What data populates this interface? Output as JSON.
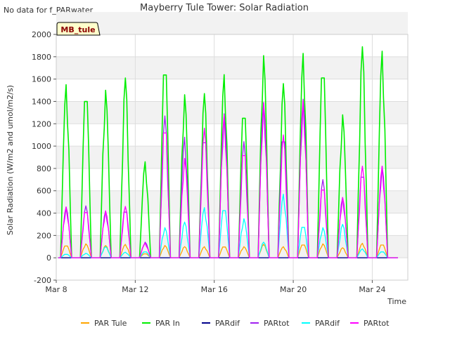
{
  "note": "No data for f_PARwater",
  "chart_data": {
    "type": "line",
    "title": "Mayberry Tule Tower: Solar Radiation",
    "xlabel": "Time",
    "ylabel": "Solar Radiation (W/m2 and umol/m2/s)",
    "badge": "MB_tule",
    "ylim": [
      -200,
      2000
    ],
    "xlim_days": [
      8,
      25.8
    ],
    "y_ticks": [
      -200,
      0,
      200,
      400,
      600,
      800,
      1000,
      1200,
      1400,
      1600,
      1800,
      2000
    ],
    "x_ticks": [
      {
        "day": 8,
        "label": "Mar 8"
      },
      {
        "day": 12,
        "label": "Mar 12"
      },
      {
        "day": 16,
        "label": "Mar 16"
      },
      {
        "day": 20,
        "label": "Mar 20"
      },
      {
        "day": 24,
        "label": "Mar 24"
      }
    ],
    "grid": true,
    "legend_position": "bottom",
    "days": [
      8.5,
      9.5,
      10.5,
      11.5,
      12.5,
      13.5,
      14.5,
      15.5,
      16.5,
      17.5,
      18.5,
      19.5,
      20.5,
      21.5,
      22.5,
      23.5,
      24.5
    ],
    "series": [
      {
        "name": "PAR Tule",
        "color": "#ffa500",
        "values": [
          120,
          125,
          110,
          120,
          40,
          110,
          100,
          100,
          110,
          100,
          120,
          100,
          130,
          125,
          90,
          130,
          130
        ]
      },
      {
        "name": "PAR In",
        "color": "#00ee00",
        "values": [
          1550,
          1590,
          1500,
          1610,
          860,
          1860,
          1460,
          1470,
          1640,
          1420,
          1810,
          1560,
          1830,
          1830,
          1280,
          1890,
          1850
        ]
      },
      {
        "name": "PARdif",
        "color": "#00008b",
        "values": [
          0,
          0,
          0,
          0,
          0,
          0,
          0,
          0,
          0,
          0,
          0,
          0,
          0,
          0,
          0,
          0,
          0
        ]
      },
      {
        "name": "PARtot",
        "color": "#a020f0",
        "values": [
          455,
          465,
          420,
          465,
          140,
          1270,
          1080,
          1170,
          1290,
          1040,
          1390,
          1180,
          1420,
          700,
          540,
          820,
          820
        ]
      },
      {
        "name": "PARdif",
        "color": "#00ffff",
        "values": [
          35,
          40,
          100,
          50,
          60,
          270,
          320,
          450,
          480,
          350,
          140,
          570,
          310,
          270,
          300,
          80,
          60
        ]
      },
      {
        "name": "PARtot",
        "color": "#ff00ff",
        "values": [
          455,
          460,
          420,
          460,
          130,
          1270,
          890,
          1160,
          1280,
          1040,
          1390,
          1100,
          1410,
          690,
          540,
          820,
          820
        ]
      }
    ]
  }
}
